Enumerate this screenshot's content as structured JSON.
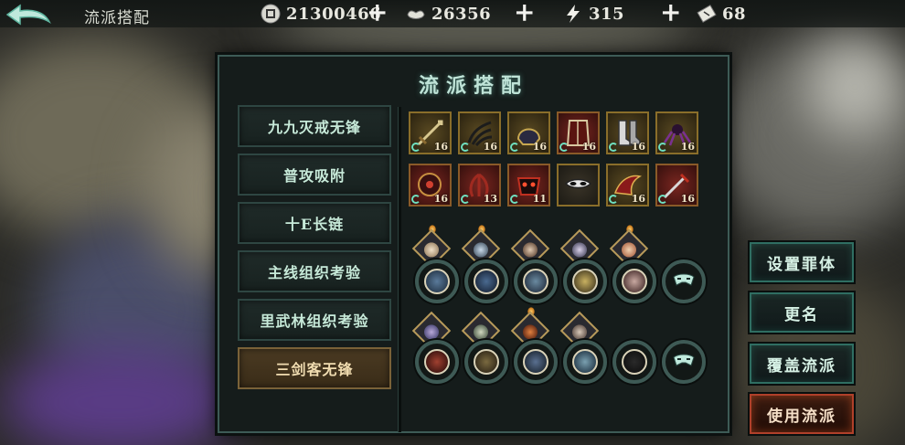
{
  "top_bar": {
    "title": "流派搭配",
    "resources": [
      {
        "icon": "coin-icon",
        "value": "21300466"
      },
      {
        "icon": "silver-ingot-icon",
        "value": "26356"
      },
      {
        "icon": "lightning-icon",
        "value": "315"
      },
      {
        "icon": "ticket-icon",
        "value": "68"
      }
    ]
  },
  "panel": {
    "title": "流派搭配",
    "presets": [
      {
        "label": "九九灭戒无锋",
        "active": false
      },
      {
        "label": "普攻吸附",
        "active": false
      },
      {
        "label": "十E长链",
        "active": false
      },
      {
        "label": "主线组织考验",
        "active": false
      },
      {
        "label": "里武林组织考验",
        "active": false
      },
      {
        "label": "三剑客无锋",
        "active": true
      }
    ],
    "equipment_rows": [
      [
        {
          "level": "16",
          "style": "gold"
        },
        {
          "level": "16",
          "style": "gold"
        },
        {
          "level": "16",
          "style": "gold"
        },
        {
          "level": "16",
          "style": "red"
        },
        {
          "level": "16",
          "style": "gold"
        },
        {
          "level": "16",
          "style": "gold"
        }
      ],
      [
        {
          "level": "16",
          "style": "red"
        },
        {
          "level": "13",
          "style": "red"
        },
        {
          "level": "11",
          "style": "red"
        },
        {
          "level": "",
          "style": "plain"
        },
        {
          "level": "16",
          "style": "gold"
        },
        {
          "level": "16",
          "style": "red"
        }
      ]
    ]
  },
  "actions": {
    "set_body": "设置罪体",
    "rename": "更名",
    "overwrite": "覆盖流派",
    "use": "使用流派"
  },
  "colors": {
    "accent_teal": "#2f6e62",
    "accent_orange": "#b0402a",
    "panel_bg": "#151c1b"
  }
}
